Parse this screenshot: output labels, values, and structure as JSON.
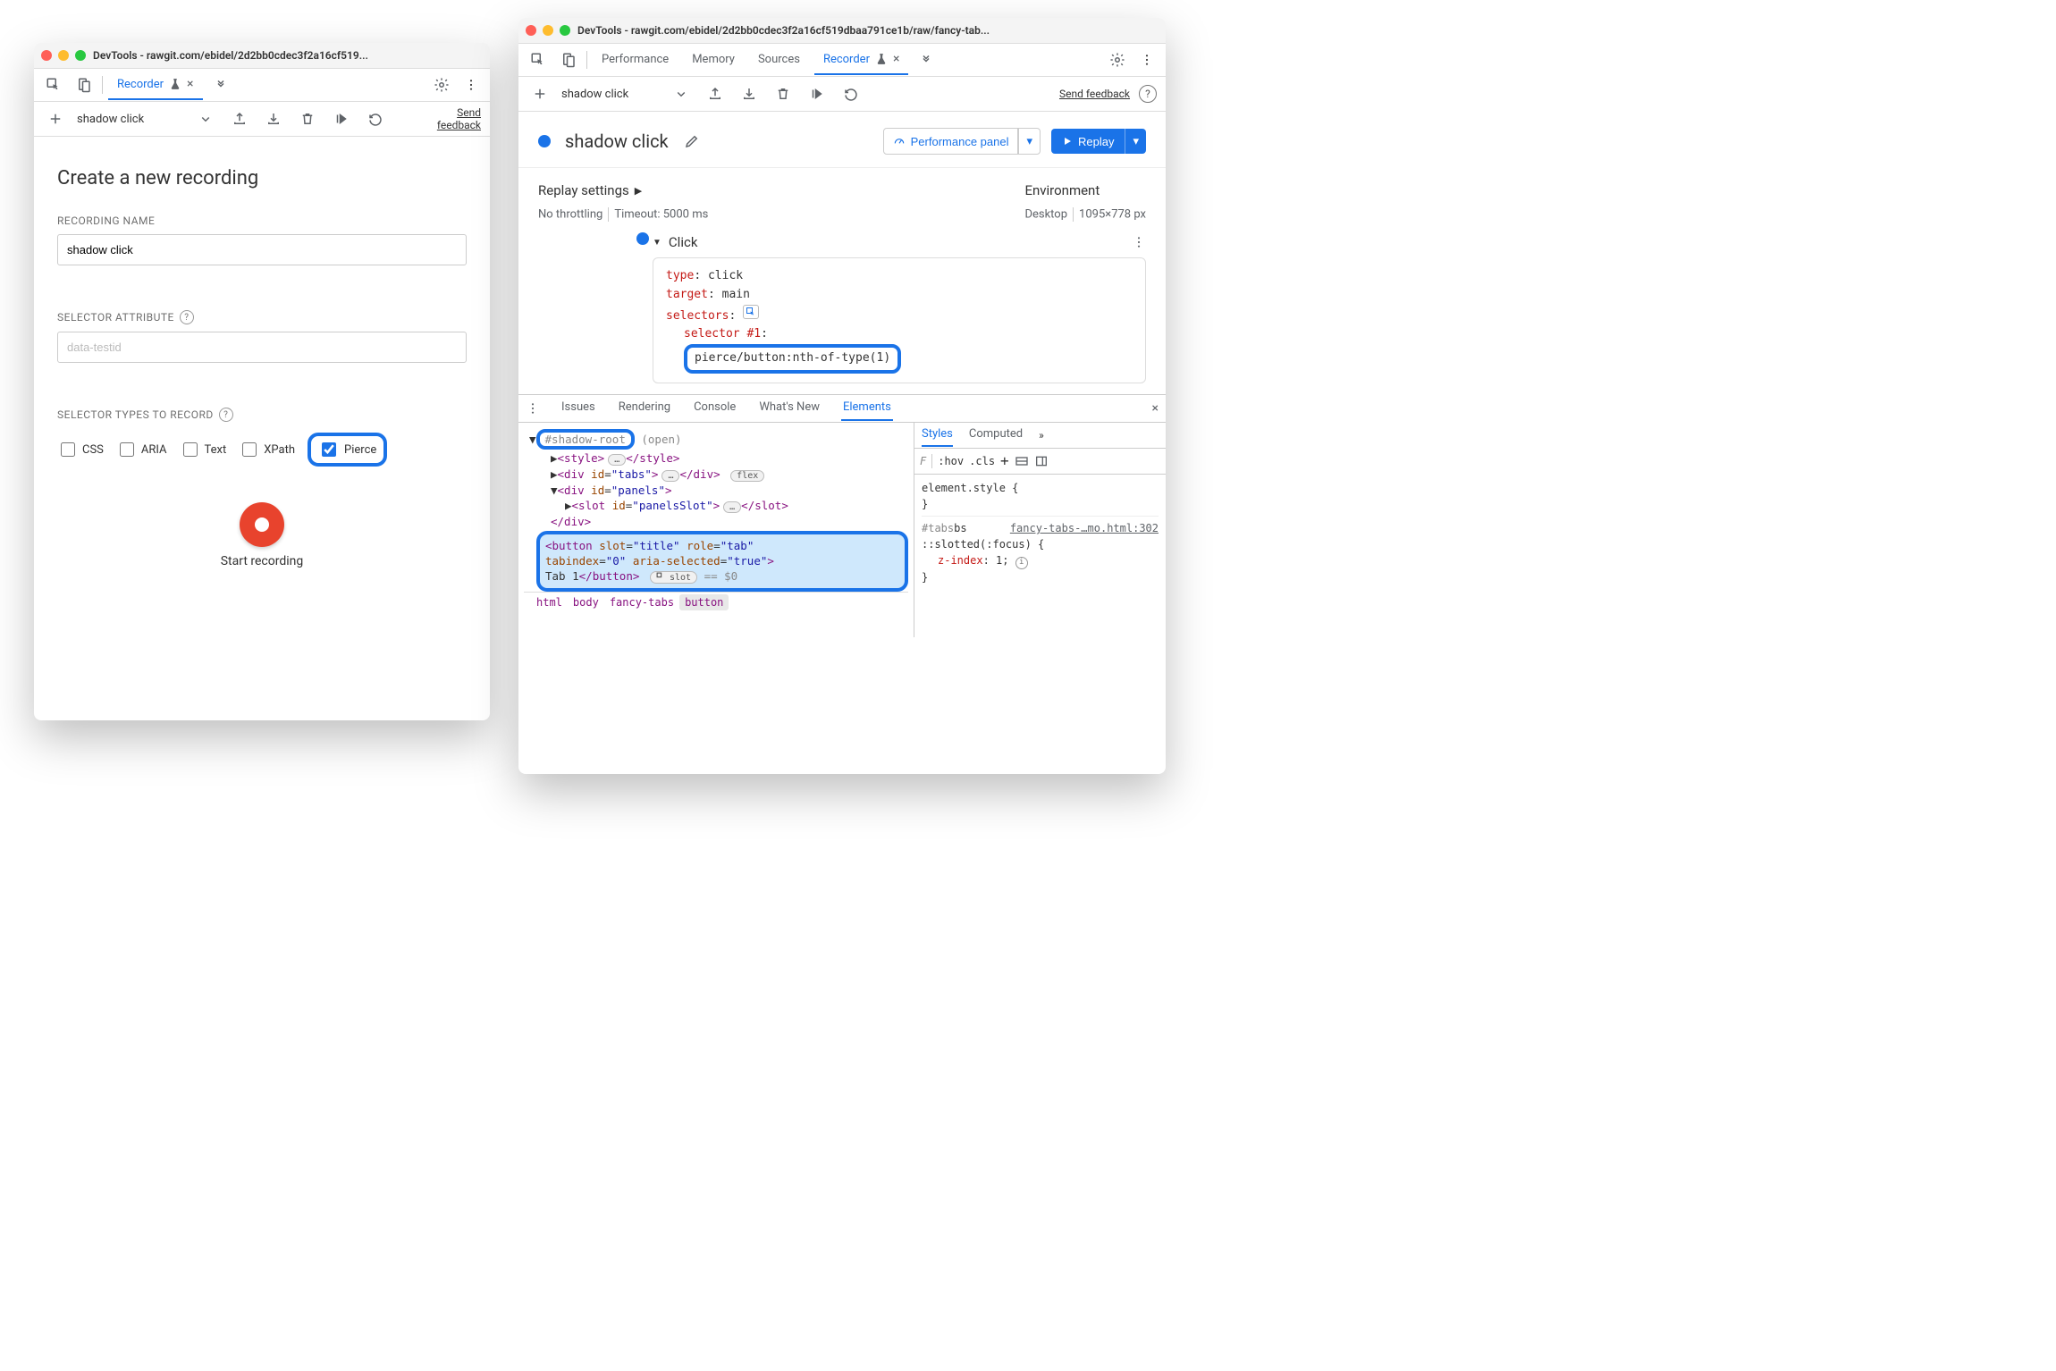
{
  "win1": {
    "title": "DevTools - rawgit.com/ebidel/2d2bb0cdec3f2a16cf519...",
    "tab_recorder": "Recorder",
    "subbar": {
      "rec_name": "shadow click",
      "send_feedback": "Send feedback"
    },
    "form": {
      "heading": "Create a new recording",
      "name_label": "RECORDING NAME",
      "name_value": "shadow click",
      "attr_label": "SELECTOR ATTRIBUTE",
      "attr_placeholder": "data-testid",
      "types_label": "SELECTOR TYPES TO RECORD",
      "types": {
        "css": "CSS",
        "aria": "ARIA",
        "text": "Text",
        "xpath": "XPath",
        "pierce": "Pierce"
      },
      "start": "Start recording"
    }
  },
  "win2": {
    "title": "DevTools - rawgit.com/ebidel/2d2bb0cdec3f2a16cf519dbaa791ce1b/raw/fancy-tab...",
    "tabs": {
      "performance": "Performance",
      "memory": "Memory",
      "sources": "Sources",
      "recorder": "Recorder"
    },
    "subbar": {
      "rec_name": "shadow click",
      "send_feedback": "Send feedback"
    },
    "header": {
      "title": "shadow click",
      "perf_panel": "Performance panel",
      "replay": "Replay"
    },
    "settings": {
      "replay_label": "Replay settings",
      "throttling": "No throttling",
      "timeout": "Timeout: 5000 ms",
      "env_label": "Environment",
      "device": "Desktop",
      "viewport": "1095×778 px"
    },
    "step": {
      "name": "Click",
      "type_k": "type",
      "type_v": "click",
      "target_k": "target",
      "target_v": "main",
      "selectors_k": "selectors",
      "sel1_k": "selector #1",
      "sel1_v": "pierce/button:nth-of-type(1)"
    },
    "drawer_tabs": {
      "issues": "Issues",
      "rendering": "Rendering",
      "console": "Console",
      "whatsnew": "What's New",
      "elements": "Elements"
    },
    "dom": {
      "shadow": "#shadow-root",
      "open": "(open)",
      "style_open": "<style>",
      "style_close": "</style>",
      "tabs_open": "<div id=\"tabs\">",
      "tabs_close": "</div>",
      "flex": "flex",
      "panels_open": "<div id=\"panels\">",
      "slot_open": "<slot id=\"panelsSlot\">",
      "slot_close": "</slot>",
      "div_close": "</div>",
      "btn1": "<button slot=\"title\" role=\"tab\"",
      "btn2": "tabindex=\"0\" aria-selected=\"true\">",
      "btn3": "Tab 1</button>",
      "slot_pill": "slot",
      "equals": "== $0"
    },
    "crumbs": {
      "html": "html",
      "body": "body",
      "fancy": "fancy-tabs",
      "button": "button"
    },
    "styles": {
      "tab_styles": "Styles",
      "tab_computed": "Computed",
      "filter_placeholder": "F",
      "hov": ":hov",
      "cls": ".cls",
      "rule1": "element.style {",
      "rule1b": "}",
      "sel": "#tabs",
      "src": "fancy-tabs-…mo.html:302",
      "slotted": "::slotted(:focus) {",
      "z": "z-index",
      "zv": "1",
      "close": "}"
    }
  }
}
